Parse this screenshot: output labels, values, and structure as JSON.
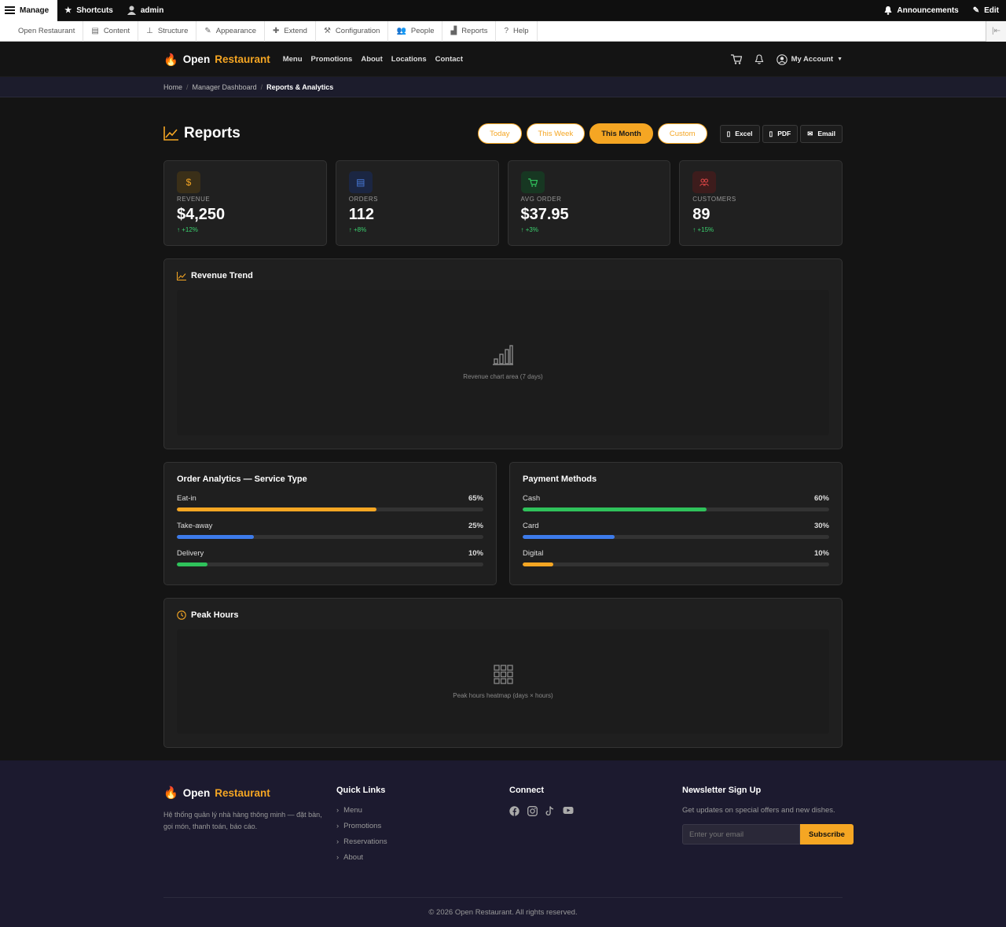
{
  "admin_bar": {
    "manage": "Manage",
    "shortcuts": "Shortcuts",
    "user": "admin",
    "announcements": "Announcements",
    "edit": "Edit"
  },
  "admin_tray": {
    "items": [
      "Open Restaurant",
      "Content",
      "Structure",
      "Appearance",
      "Extend",
      "Configuration",
      "People",
      "Reports",
      "Help"
    ]
  },
  "header": {
    "logo_word1": "Open",
    "logo_word2": "Restaurant",
    "nav": [
      "Menu",
      "Promotions",
      "About",
      "Locations",
      "Contact"
    ],
    "account": "My Account"
  },
  "breadcrumb": [
    "Home",
    "Manager Dashboard",
    "Reports & Analytics"
  ],
  "page": {
    "title": "Reports",
    "filters": [
      "Today",
      "This Week",
      "This Month",
      "Custom"
    ],
    "active_filter": "This Month",
    "exports": [
      "Excel",
      "PDF",
      "Email"
    ]
  },
  "stats": [
    {
      "label": "REVENUE",
      "value": "$4,250",
      "delta": "+12%",
      "icon": "dollar-icon",
      "color": "#f5a623"
    },
    {
      "label": "ORDERS",
      "value": "112",
      "delta": "+8%",
      "icon": "document-icon",
      "color": "#4a7ee0"
    },
    {
      "label": "AVG ORDER",
      "value": "$37.95",
      "delta": "+3%",
      "icon": "cart-icon",
      "color": "#31c35d"
    },
    {
      "label": "CUSTOMERS",
      "value": "89",
      "delta": "+15%",
      "icon": "users-icon",
      "color": "#e04747"
    }
  ],
  "revenue_trend": {
    "title": "Revenue Trend",
    "placeholder": "Revenue chart area (7 days)"
  },
  "order_analytics": {
    "title": "Order Analytics — Service Type",
    "rows": [
      {
        "label": "Eat-in",
        "pct": "65%",
        "value": 0.65,
        "color": "#f5a623"
      },
      {
        "label": "Take-away",
        "pct": "25%",
        "value": 0.25,
        "color": "#3d7bea"
      },
      {
        "label": "Delivery",
        "pct": "10%",
        "value": 0.1,
        "color": "#2fc25b"
      }
    ]
  },
  "payment_methods": {
    "title": "Payment Methods",
    "rows": [
      {
        "label": "Cash",
        "pct": "60%",
        "value": 0.6,
        "color": "#2fc25b"
      },
      {
        "label": "Card",
        "pct": "30%",
        "value": 0.3,
        "color": "#3d7bea"
      },
      {
        "label": "Digital",
        "pct": "10%",
        "value": 0.1,
        "color": "#f5a623"
      }
    ]
  },
  "peak_hours": {
    "title": "Peak Hours",
    "placeholder": "Peak hours heatmap (days × hours)"
  },
  "footer": {
    "logo_word1": "Open",
    "logo_word2": "Restaurant",
    "description": "Hệ thống quản lý nhà hàng thông minh — đặt bàn, gọi món, thanh toán, báo cáo.",
    "quick_links_title": "Quick Links",
    "quick_links": [
      "Menu",
      "Promotions",
      "Reservations",
      "About"
    ],
    "connect_title": "Connect",
    "newsletter_title": "Newsletter Sign Up",
    "newsletter_text": "Get updates on special offers and new dishes.",
    "newsletter_placeholder": "Enter your email",
    "subscribe": "Subscribe",
    "copyright": "© 2026 Open Restaurant. All rights reserved."
  }
}
